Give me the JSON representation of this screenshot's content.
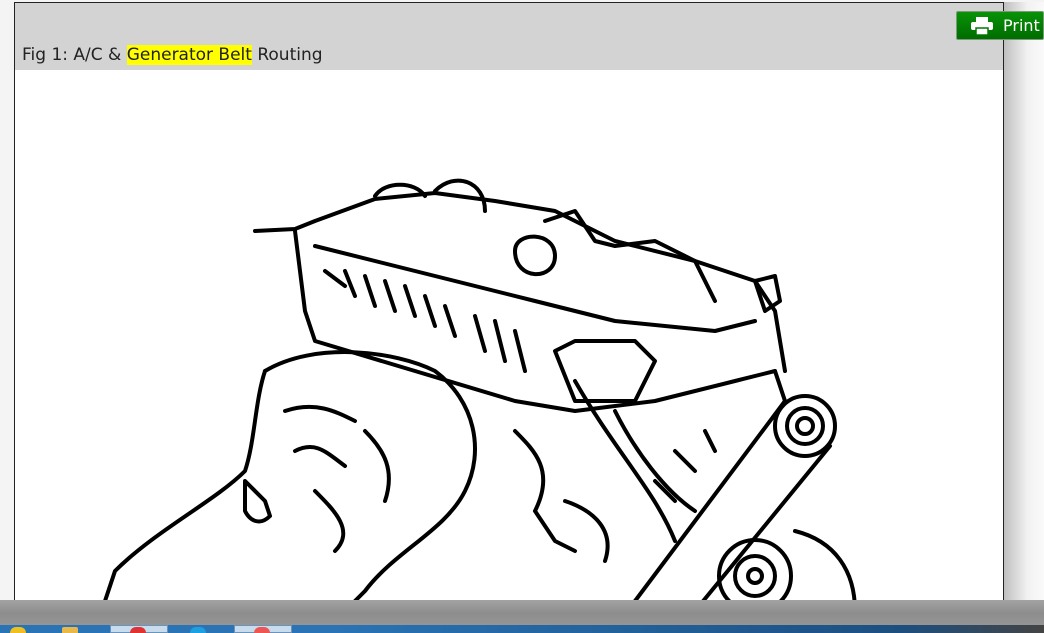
{
  "figure": {
    "caption_prefix": "Fig 1: A/C & ",
    "caption_highlight": "Generator Belt",
    "caption_suffix": " Routing"
  },
  "toolbar": {
    "print_label": "Print",
    "print_icon": "printer-icon"
  },
  "colors": {
    "print_button": "#008000",
    "highlight": "#ffff00",
    "header": "#d3d3d3"
  }
}
